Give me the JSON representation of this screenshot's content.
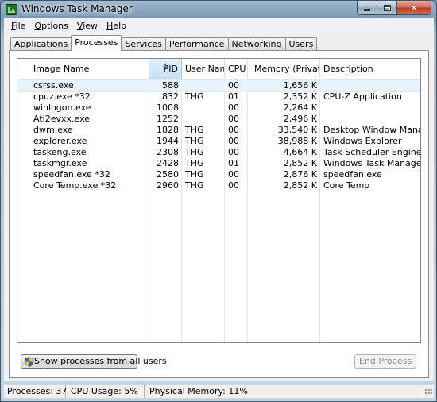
{
  "window": {
    "title": "Windows Task Manager"
  },
  "caption": {
    "minimize": "",
    "maximize": "",
    "close": "✕"
  },
  "menu": [
    {
      "accel": "F",
      "rest": "ile"
    },
    {
      "accel": "O",
      "rest": "ptions"
    },
    {
      "accel": "V",
      "rest": "iew"
    },
    {
      "accel": "H",
      "rest": "elp"
    }
  ],
  "tabs": [
    {
      "label": "Applications",
      "active": false
    },
    {
      "label": "Processes",
      "active": true
    },
    {
      "label": "Services",
      "active": false
    },
    {
      "label": "Performance",
      "active": false
    },
    {
      "label": "Networking",
      "active": false
    },
    {
      "label": "Users",
      "active": false
    }
  ],
  "table": {
    "columns": [
      "Image Name",
      "PID",
      "User Name",
      "CPU",
      "Memory (Private ...",
      "Description"
    ],
    "sorted_column": "PID",
    "rows": [
      {
        "image": "csrss.exe",
        "pid": "588",
        "user": "",
        "cpu": "00",
        "memory": "1,656 K",
        "desc": "",
        "selected": true
      },
      {
        "image": "cpuz.exe *32",
        "pid": "832",
        "user": "THG",
        "cpu": "01",
        "memory": "2,352 K",
        "desc": "CPU-Z Application",
        "selected": false
      },
      {
        "image": "winlogon.exe",
        "pid": "1008",
        "user": "",
        "cpu": "00",
        "memory": "2,264 K",
        "desc": "",
        "selected": false
      },
      {
        "image": "Ati2evxx.exe",
        "pid": "1252",
        "user": "",
        "cpu": "00",
        "memory": "2,496 K",
        "desc": "",
        "selected": false
      },
      {
        "image": "dwm.exe",
        "pid": "1828",
        "user": "THG",
        "cpu": "00",
        "memory": "33,540 K",
        "desc": "Desktop Window Manager",
        "selected": false
      },
      {
        "image": "explorer.exe",
        "pid": "1944",
        "user": "THG",
        "cpu": "00",
        "memory": "38,988 K",
        "desc": "Windows Explorer",
        "selected": false
      },
      {
        "image": "taskeng.exe",
        "pid": "2308",
        "user": "THG",
        "cpu": "00",
        "memory": "4,664 K",
        "desc": "Task Scheduler Engine",
        "selected": false
      },
      {
        "image": "taskmgr.exe",
        "pid": "2428",
        "user": "THG",
        "cpu": "01",
        "memory": "2,852 K",
        "desc": "Windows Task Manager",
        "selected": false
      },
      {
        "image": "speedfan.exe *32",
        "pid": "2580",
        "user": "THG",
        "cpu": "00",
        "memory": "2,876 K",
        "desc": "speedfan.exe",
        "selected": false
      },
      {
        "image": "Core Temp.exe *32",
        "pid": "2960",
        "user": "THG",
        "cpu": "00",
        "memory": "2,852 K",
        "desc": "Core Temp",
        "selected": false
      }
    ]
  },
  "buttons": {
    "show_all_accel": "S",
    "show_all_rest": "how processes from all users",
    "end_process": "End Process"
  },
  "status": {
    "processes": "Processes: 37",
    "cpu": "CPU Usage: 5%",
    "memory": "Physical Memory: 11%"
  },
  "colors": {
    "selected_row": "#e8f3fb",
    "sorted_header": "#c4e0f5"
  },
  "icons": {
    "app": "task-manager-icon",
    "shield": "uac-shield-icon"
  }
}
